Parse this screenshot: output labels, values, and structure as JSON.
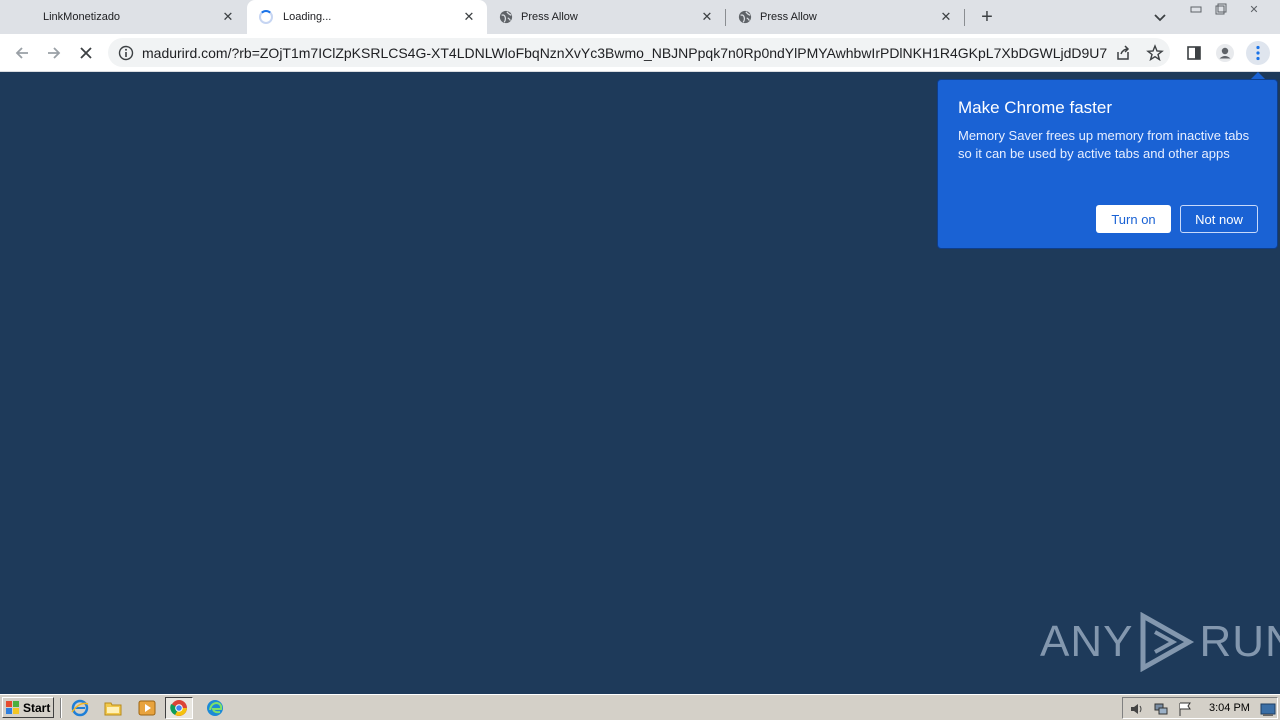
{
  "tabs": [
    {
      "title": "LinkMonetizado",
      "state": "inactive"
    },
    {
      "title": "Loading...",
      "state": "active-loading"
    },
    {
      "title": "Press Allow",
      "state": "inactive"
    },
    {
      "title": "Press Allow",
      "state": "inactive"
    }
  ],
  "toolbar": {
    "url": "madurird.com/?rb=ZOjT1m7IClZpKSRLCS4G-XT4LDNLWloFbqNznXvYc3Bwmo_NBJNPpqk7n0Rp0ndYlPMYAwhbwIrPDlNKH1R4GKpL7XbDGWLjdD9U72mv..."
  },
  "popup": {
    "title": "Make Chrome faster",
    "body": "Memory Saver frees up memory from inactive tabs so it can be used by active tabs and other apps",
    "primary_label": "Turn on",
    "secondary_label": "Not now"
  },
  "watermark": {
    "left": "ANY",
    "right": "RUN"
  },
  "taskbar": {
    "start_label": "Start",
    "clock": "3:04 PM"
  },
  "colors": {
    "page_bg": "#1e3a5a",
    "popup_bg": "#1a62d4",
    "tabstrip_bg": "#dee1e6",
    "taskbar_bg": "#d4d0c8"
  }
}
